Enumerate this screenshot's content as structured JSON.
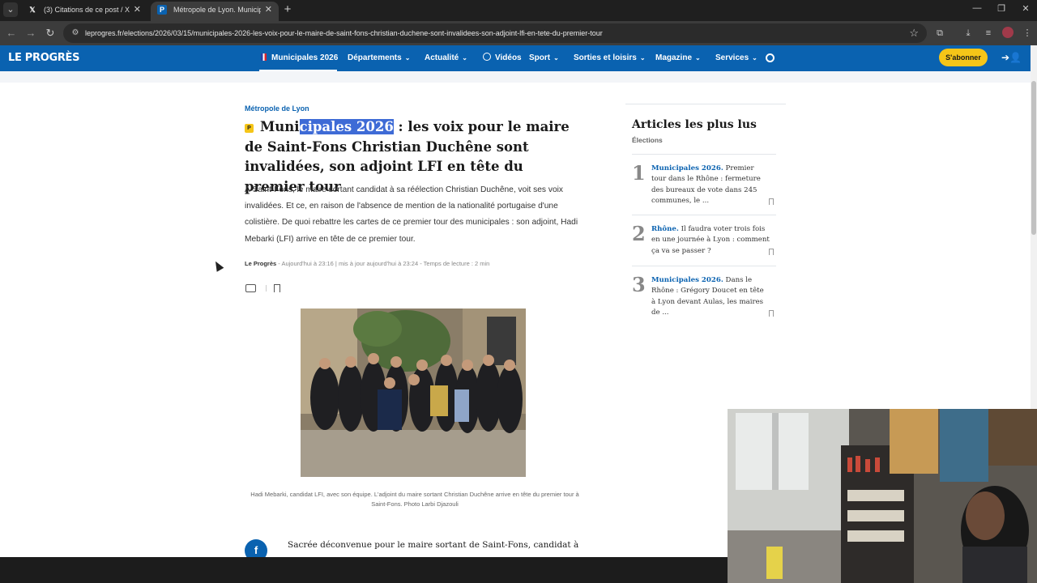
{
  "browser": {
    "tabs": [
      {
        "title": "(3) Citations de ce post / X",
        "favicon": "x-logo",
        "active": false
      },
      {
        "title": "Métropole de Lyon. Municipales",
        "favicon": "le-progres-p",
        "active": true
      }
    ],
    "url": "leprogres.fr/elections/2026/03/15/municipales-2026-les-voix-pour-le-maire-de-saint-fons-christian-duchene-sont-invalidees-son-adjoint-lfi-en-tete-du-premier-tour"
  },
  "site": {
    "logo": "LE PROGRÈS",
    "nav": [
      {
        "label": "Municipales 2026",
        "icon": "flag-fr-icon",
        "chevron": false
      },
      {
        "label": "Départements",
        "chevron": true
      },
      {
        "label": "Actualité",
        "chevron": true
      },
      {
        "label": "Vidéos",
        "icon": "play-icon",
        "chevron": false
      },
      {
        "label": "Sport",
        "chevron": true
      },
      {
        "label": "Sorties et loisirs",
        "chevron": true
      },
      {
        "label": "Magazine",
        "chevron": true
      },
      {
        "label": "Services",
        "chevron": true
      }
    ],
    "subscribe": "S'abonner",
    "brand_color": "#0a62b0",
    "accent_color": "#f5c518"
  },
  "article": {
    "section": "Métropole de Lyon",
    "premium_badge": "P",
    "title_pre": "Muni",
    "title_highlight": "cipales 2026",
    "title_post": " : les voix pour le maire de Saint-Fons Christian Duchêne sont invalidées, son adjoint LFI en tête du premier tour",
    "lede": "À Saint-Fons, le maire sortant candidat à sa réélection Christian Duchêne, voit ses voix invalidées. Et ce, en raison de l'absence de mention de la nationalité portugaise d'une colistière. De quoi rebattre les cartes de ce premier tour des municipales : son adjoint, Hadi Mebarki (LFI) arrive en tête de ce premier tour.",
    "byline_source": "Le Progrès",
    "byline_meta": " - Aujourd'hui à 23:16 | mis à jour aujourd'hui à 23:24 - Temps de lecture : 2 min",
    "photo_caption": "Hadi Mebarki, candidat LFI, avec son équipe. L'adjoint du maire sortant Christian Duchêne arrive en tête du premier tour à Saint-Fons.  Photo Larbi Djazouli",
    "body_first_line": "Sacrée déconvenue pour le maire sortant de Saint-Fons, candidat à",
    "share_facebook": "f"
  },
  "sidebar": {
    "title": "Articles les plus lus",
    "subtitle": "Élections",
    "items": [
      {
        "rank": "1",
        "kicker": "Municipales 2026.",
        "text": " Premier tour dans le Rhône : fermeture des bureaux de vote dans 245 communes, le ..."
      },
      {
        "rank": "2",
        "kicker": "Rhône.",
        "text": " Il faudra voter trois fois en une journée à Lyon : comment ça va se passer ?"
      },
      {
        "rank": "3",
        "kicker": "Municipales 2026.",
        "text": " Dans le Rhône : Grégory Doucet en tête à Lyon devant Aulas, les maires de ..."
      }
    ]
  }
}
